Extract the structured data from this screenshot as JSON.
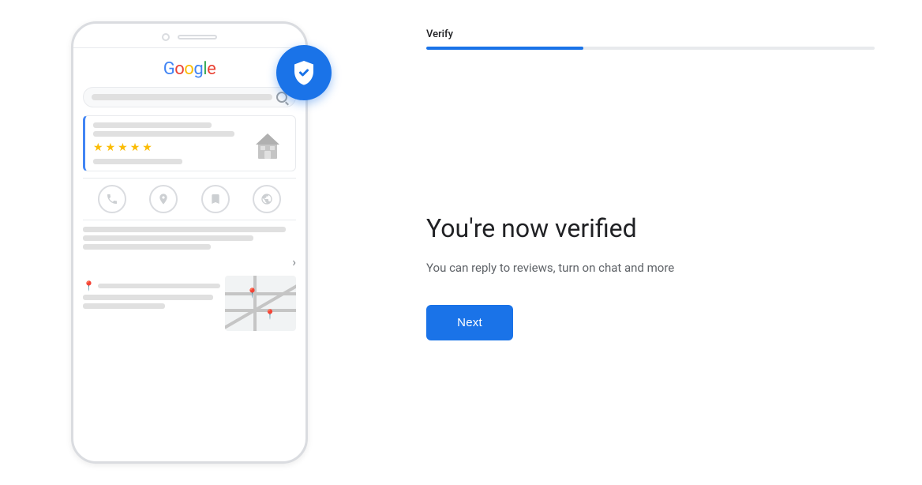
{
  "left": {
    "google_logo": {
      "g": "G",
      "o1": "o",
      "o2": "o",
      "g2": "g",
      "l": "l",
      "e": "e"
    },
    "shield_icon": "✓",
    "stars": [
      "★",
      "★",
      "★",
      "★",
      "★"
    ],
    "arrow": "›",
    "map_pins": [
      "📍",
      "📍"
    ]
  },
  "right": {
    "step_label": "Verify",
    "progress_percent": 35,
    "title": "You're now verified",
    "subtitle": "You can reply to reviews, turn on chat and more",
    "next_button_label": "Next"
  }
}
